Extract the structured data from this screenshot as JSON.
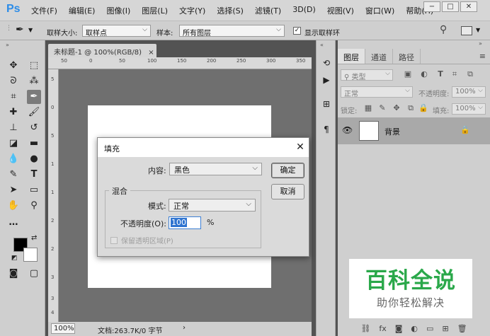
{
  "app": {
    "logo": "Ps",
    "menu": [
      "文件(F)",
      "编辑(E)",
      "图像(I)",
      "图层(L)",
      "文字(Y)",
      "选择(S)",
      "滤镜(T)",
      "3D(D)",
      "视图(V)",
      "窗口(W)",
      "帮助(H)"
    ]
  },
  "options_bar": {
    "sample_size_label": "取样大小:",
    "sample_size_value": "取样点",
    "sample_label": "样本:",
    "sample_value": "所有图层",
    "show_ring_label": "显示取样环"
  },
  "document": {
    "tab_title": "未标题-1 @ 100%(RGB/8)",
    "tab_close": "×",
    "ruler_top": [
      "50",
      "0",
      "50",
      "100",
      "150",
      "200",
      "250",
      "300",
      "350"
    ],
    "ruler_left": [
      "5",
      "0",
      "5",
      "1",
      "1",
      "2",
      "2",
      "3",
      "3",
      "4"
    ],
    "zoom": "100%",
    "doc_info": "文档:263.7K/0 字节"
  },
  "layers_panel": {
    "tabs": [
      "图层",
      "通道",
      "路径"
    ],
    "filter_kind": "类型",
    "blend_mode": "正常",
    "opacity_label": "不透明度:",
    "opacity_value": "100%",
    "lock_label": "锁定:",
    "fill_label": "填充:",
    "fill_value": "100%",
    "layer_name": "背景"
  },
  "fill_dialog": {
    "title": "填充",
    "contents_label": "内容:",
    "contents_value": "黑色",
    "ok_label": "确定",
    "cancel_label": "取消",
    "blending_group_label": "混合",
    "mode_label": "模式:",
    "mode_value": "正常",
    "opacity_label": "不透明度(O):",
    "opacity_value": "100",
    "opacity_unit": "%",
    "preserve_transparency_label": "保留透明区域(P)"
  },
  "watermark": {
    "title": "百科全说",
    "subtitle": "助你轻松解决"
  },
  "colors": {
    "foreground": "#000000",
    "background": "#ffffff",
    "watermark_green": "#2aa84a",
    "ps_blue": "#2c8ce8"
  }
}
